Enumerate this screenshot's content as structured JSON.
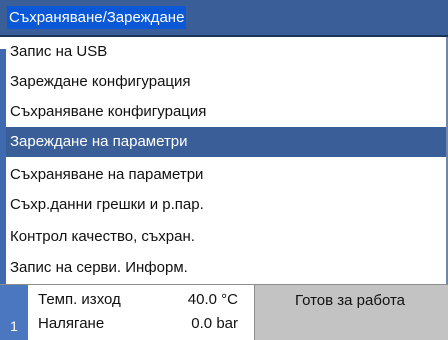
{
  "title": "Съхраняване/Зареждане",
  "menu": {
    "items": [
      {
        "label": "Запис на USB",
        "selected": false
      },
      {
        "label": "Зареждане конфигурация",
        "selected": false
      },
      {
        "label": "Съхраняване конфигурация",
        "selected": false
      },
      {
        "label": "Зареждане на параметри",
        "selected": true
      },
      {
        "label": "Съхраняване на параметри",
        "selected": false
      },
      {
        "label": "Съхр.данни грешки и р.пар.",
        "selected": false
      },
      {
        "label": "Контрол качество, съхран.",
        "selected": false
      },
      {
        "label": "Запис на серви. Информ.",
        "selected": false
      }
    ]
  },
  "status_bar": {
    "page_number": "1",
    "readouts": [
      {
        "label": "Темп. изход",
        "value": "40.0 °C"
      },
      {
        "label": "Налягане",
        "value": "0.0 bar"
      }
    ],
    "status": "Готов за работа"
  },
  "colors": {
    "title_bar": "#3a5f98",
    "title_highlight": "#0a58d6",
    "selected_item": "#3a5f98",
    "page_tab": "#4b77c0",
    "status_bar": "#c3c3c3"
  }
}
